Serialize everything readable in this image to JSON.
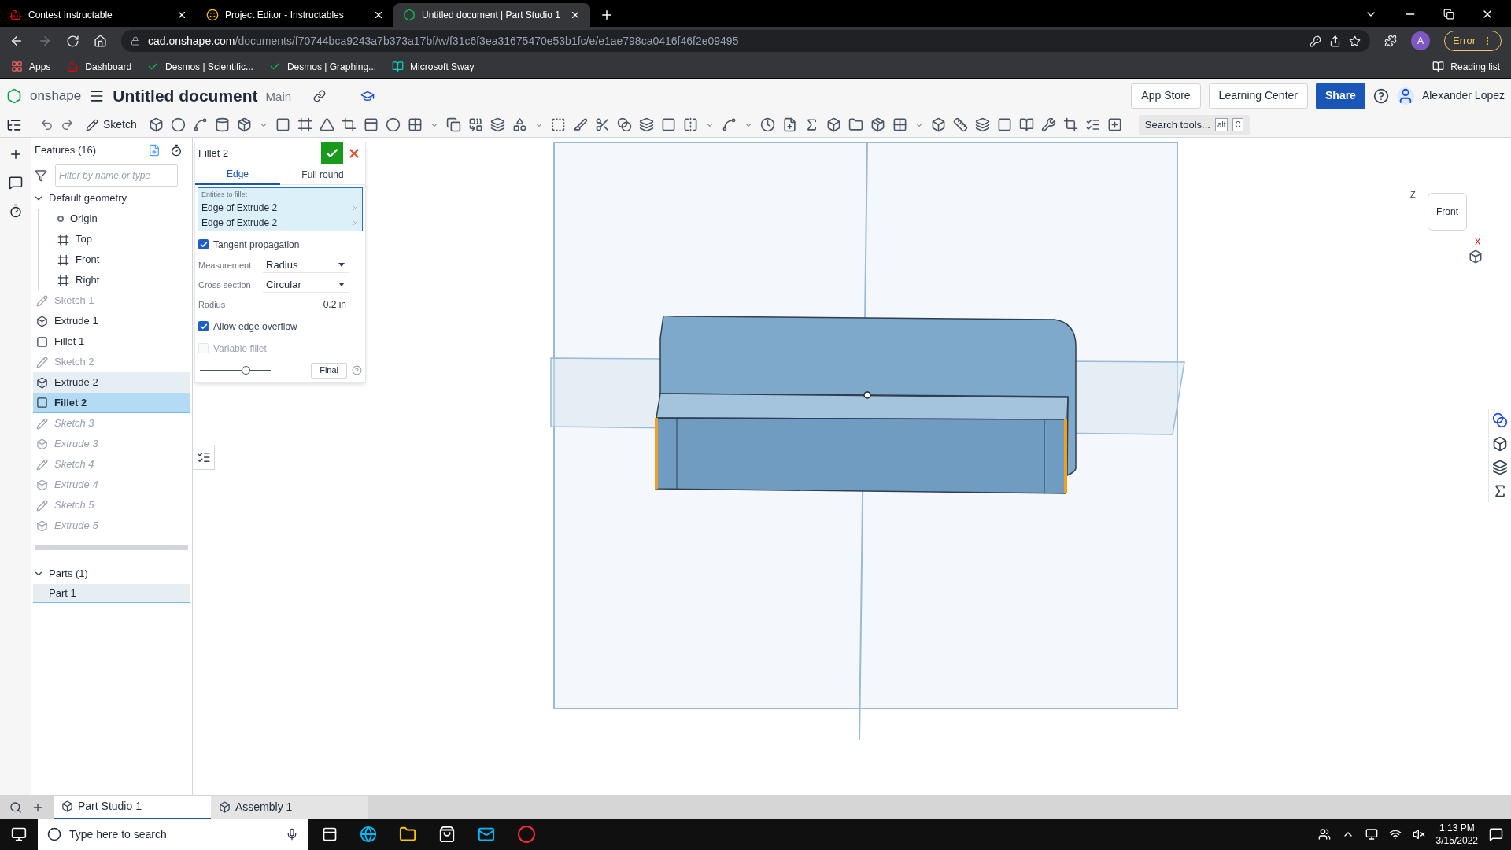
{
  "browser": {
    "tabs": [
      {
        "title": "Contest Instructable",
        "selected": false
      },
      {
        "title": "Project Editor - Instructables",
        "selected": false
      },
      {
        "title": "Untitled document | Part Studio 1",
        "selected": true
      }
    ],
    "address": {
      "host": "cad.onshape.com",
      "path": "/documents/f70744bca9243a7b373a17bf/w/f31c6f3ea31675470e53b1fc/e/e1ae798ca0416f46f2e09495"
    },
    "profile_initial": "A",
    "error_label": "Error",
    "bookmarks": [
      "Apps",
      "Dashboard",
      "Desmos | Scientific...",
      "Desmos | Graphing...",
      "Microsoft Sway"
    ],
    "reading_list": "Reading list"
  },
  "app": {
    "logo": "onshape",
    "title": "Untitled document",
    "branch": "Main",
    "buttons": [
      "App Store",
      "Learning Center"
    ],
    "share": "Share",
    "user": "Alexander Lopez"
  },
  "toolbar": {
    "sketch": "Sketch",
    "search": "Search tools...",
    "keys": [
      "alt",
      "C"
    ]
  },
  "features": {
    "header": "Features (16)",
    "filter_placeholder": "Filter by name or type",
    "tree": [
      {
        "label": "Default geometry",
        "kind": "group",
        "expanded": true,
        "children": [
          {
            "label": "Origin",
            "kind": "point"
          },
          {
            "label": "Top",
            "kind": "plane"
          },
          {
            "label": "Front",
            "kind": "plane"
          },
          {
            "label": "Right",
            "kind": "plane"
          }
        ]
      },
      {
        "label": "Sketch 1",
        "kind": "sketch",
        "hidden": true,
        "rolled_back": false,
        "selected": false,
        "highlighted": false
      },
      {
        "label": "Extrude 1",
        "kind": "extrude",
        "hidden": false,
        "rolled_back": false,
        "selected": false,
        "highlighted": false
      },
      {
        "label": "Fillet 1",
        "kind": "fillet",
        "hidden": false,
        "rolled_back": false,
        "selected": false,
        "highlighted": false
      },
      {
        "label": "Sketch 2",
        "kind": "sketch",
        "hidden": true,
        "rolled_back": false,
        "selected": false,
        "highlighted": false
      },
      {
        "label": "Extrude 2",
        "kind": "extrude",
        "hidden": false,
        "rolled_back": false,
        "selected": false,
        "highlighted": true
      },
      {
        "label": "Fillet 2",
        "kind": "fillet",
        "hidden": false,
        "rolled_back": false,
        "selected": true,
        "highlighted": false
      },
      {
        "label": "Sketch 3",
        "kind": "sketch",
        "hidden": false,
        "rolled_back": true,
        "selected": false,
        "highlighted": false
      },
      {
        "label": "Extrude 3",
        "kind": "extrude",
        "hidden": false,
        "rolled_back": true,
        "selected": false,
        "highlighted": false
      },
      {
        "label": "Sketch 4",
        "kind": "sketch",
        "hidden": false,
        "rolled_back": true,
        "selected": false,
        "highlighted": false
      },
      {
        "label": "Extrude 4",
        "kind": "extrude",
        "hidden": false,
        "rolled_back": true,
        "selected": false,
        "highlighted": false
      },
      {
        "label": "Sketch 5",
        "kind": "sketch",
        "hidden": false,
        "rolled_back": true,
        "selected": false,
        "highlighted": false
      },
      {
        "label": "Extrude 5",
        "kind": "extrude",
        "hidden": false,
        "rolled_back": true,
        "selected": false,
        "highlighted": false
      }
    ]
  },
  "parts": {
    "header": "Parts (1)",
    "expanded": true,
    "items": [
      {
        "label": "Part 1",
        "selected": false,
        "highlighted": true
      }
    ]
  },
  "dialog": {
    "title": "Fillet 2",
    "tabs": [
      {
        "label": "Edge",
        "selected": true
      },
      {
        "label": "Full round",
        "selected": false
      }
    ],
    "entities_label": "Entities to fillet",
    "entities": [
      "Edge of Extrude 2",
      "Edge of Extrude 2"
    ],
    "fields": [
      {
        "kind": "checkbox",
        "label": "Tangent propagation",
        "checked": true,
        "disabled": false
      },
      {
        "kind": "select",
        "label": "Measurement",
        "value": "Radius"
      },
      {
        "kind": "select",
        "label": "Cross section",
        "value": "Circular"
      },
      {
        "kind": "number",
        "label": "Radius",
        "value": "0.2 in"
      },
      {
        "kind": "checkbox",
        "label": "Allow edge overflow",
        "checked": true,
        "disabled": false
      },
      {
        "kind": "checkbox",
        "label": "Variable fillet",
        "checked": false,
        "disabled": true
      }
    ],
    "slider": {
      "level": 0.65
    },
    "final": "Final"
  },
  "viewcube": {
    "face": "Front",
    "axes": [
      "Z",
      "X"
    ]
  },
  "bottom_tabs": [
    {
      "label": "Part Studio 1",
      "selected": true
    },
    {
      "label": "Assembly 1",
      "selected": false
    }
  ],
  "taskbar": {
    "search_placeholder": "Type here to search",
    "time": "1:13 PM",
    "date": "3/15/2022"
  }
}
